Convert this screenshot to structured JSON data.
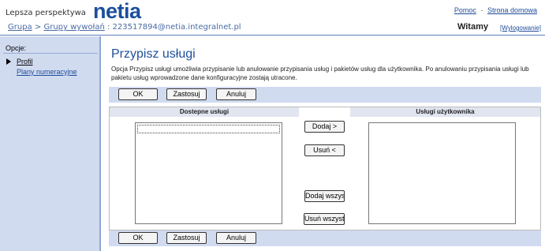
{
  "header": {
    "tagline": "Lepsza perspektywa",
    "logo": "netia",
    "links": {
      "help": "Pomoc",
      "separator": "-",
      "home": "Strona domowa"
    },
    "breadcrumb": {
      "group": "Grupa",
      "sep1": ">",
      "call_groups": "Grupy wywołań",
      "sep2": ":",
      "account": "223517894@netia.integralnet.pl"
    },
    "welcome": "Witamy",
    "logout": "[Wylogowanie]"
  },
  "sidebar": {
    "title": "Opcje:",
    "items": [
      {
        "label": "Profil"
      },
      {
        "label": "Plany numeracyjne"
      }
    ]
  },
  "main": {
    "title": "Przypisz usługi",
    "description": "Opcja Przypisz usługi umożliwia przypisanie lub anulowanie przypisania usług i pakietów usług dla użytkownika. Po anulowaniu przypisania usługi lub pakietu usług wprowadzone dane konfiguracyjne zostają utracone.",
    "buttons": {
      "ok": "OK",
      "apply": "Zastosuj",
      "cancel": "Anuluj"
    },
    "available_header": "Dostepne usługi",
    "user_header": "Usługi użytkownika",
    "move_buttons": {
      "add": "Dodaj >",
      "remove": "Usuń <",
      "add_all": "Dodaj wszys",
      "remove_all": "Usuń wszyst"
    }
  }
}
